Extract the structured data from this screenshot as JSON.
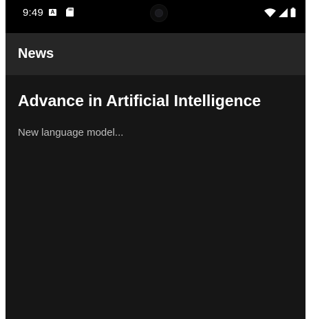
{
  "status_bar": {
    "time": "9:49",
    "notification_icon_letter": "A",
    "icons": [
      "a-notification-icon",
      "sd-card-icon",
      "camera-icon",
      "wifi-icon",
      "cellular-signal-icon",
      "battery-icon"
    ]
  },
  "app_bar": {
    "title": "News"
  },
  "article": {
    "title": "Advance in Artificial Intelligence",
    "snippet": "New language model..."
  },
  "colors": {
    "background": "#161616",
    "app_bar": "#262626",
    "status_bar": "#000000",
    "title_text": "#ffffff",
    "snippet_text": "#bdbdbd"
  }
}
